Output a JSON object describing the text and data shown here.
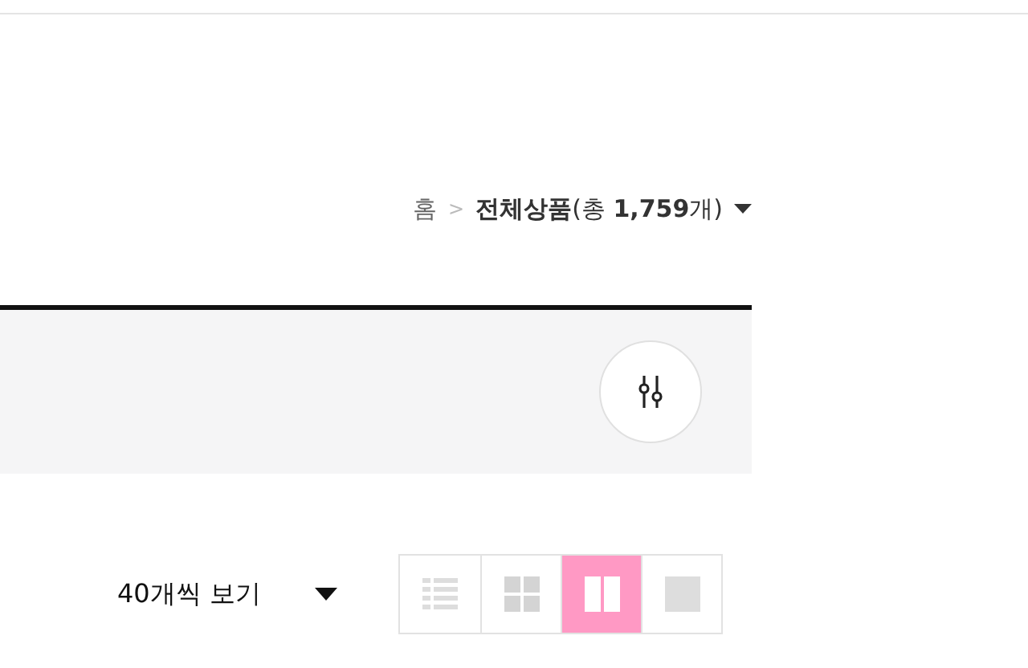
{
  "breadcrumb": {
    "home": "홈",
    "separator": ">",
    "current": "**전체상품**(총 **1,759**개)"
  },
  "toolbar": {
    "page_size": "40개씩 보기",
    "views": [
      {
        "kind": "list",
        "selected": false
      },
      {
        "kind": "grid",
        "selected": false
      },
      {
        "kind": "two",
        "selected": true
      },
      {
        "kind": "single",
        "selected": false
      }
    ]
  }
}
